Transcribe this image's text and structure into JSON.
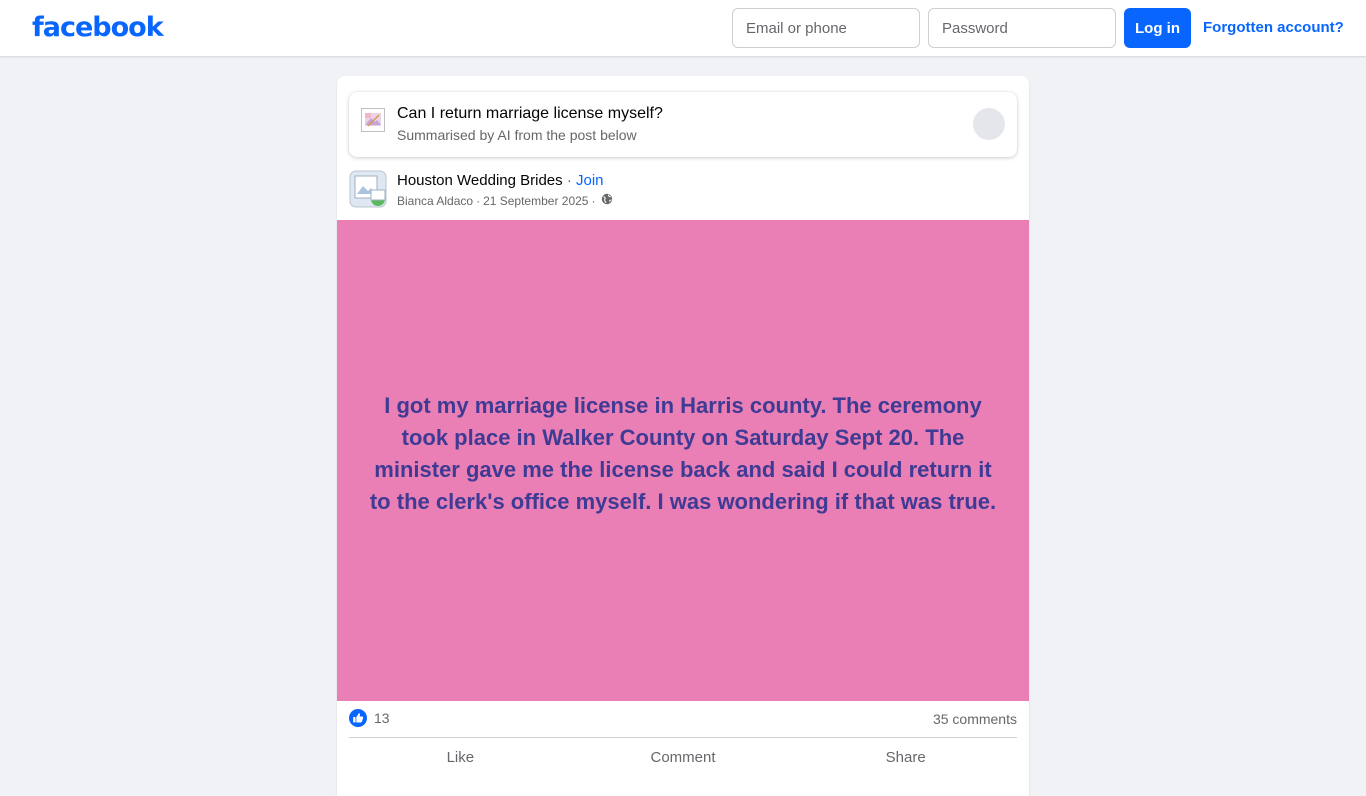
{
  "header": {
    "logo_text": "facebook",
    "email_placeholder": "Email or phone",
    "password_placeholder": "Password",
    "login_label": "Log in",
    "forgot_label": "Forgotten account?"
  },
  "ai_summary": {
    "title": "Can I return marriage license myself?",
    "subtitle": "Summarised by AI from the post below"
  },
  "post": {
    "group_name": "Houston Wedding Brides",
    "separator": "·",
    "join_label": "Join",
    "author": "Bianca Aldaco",
    "date": "21 September 2025",
    "visibility_icon": "globe-icon",
    "background_color": "#e97fb5",
    "text_color": "#3f3a94",
    "text": "I got my marriage license in Harris county. The ceremony took place in Walker County on Saturday Sept 20. The minister gave me the license back and said I could return it to the clerk's office myself. I was wondering if that was true."
  },
  "stats": {
    "reaction_icon": "like-icon",
    "reactions_count": "13",
    "comments_label": "35 comments"
  },
  "actions": {
    "like_label": "Like",
    "comment_label": "Comment",
    "share_label": "Share"
  },
  "colors": {
    "brand": "#0866ff",
    "page_bg": "#f0f2f5"
  }
}
